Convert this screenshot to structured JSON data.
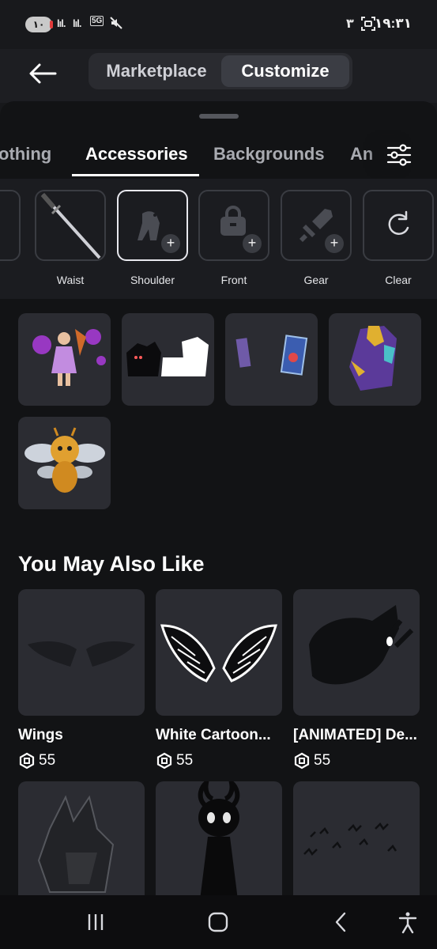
{
  "status_bar": {
    "battery": "١٠",
    "network": "5G",
    "time": "١٩:٣١",
    "sim_indicator": "٣",
    "signal_1": "lıl.",
    "signal_2": "lıl."
  },
  "header": {
    "back_icon": "arrow-left-icon",
    "tabs": [
      {
        "label": "Marketplace",
        "active": false
      },
      {
        "label": "Customize",
        "active": true
      }
    ]
  },
  "category_tabs": [
    {
      "label": "Clothing",
      "visible_text": "othing",
      "active": false
    },
    {
      "label": "Accessories",
      "visible_text": "Accessories",
      "active": true
    },
    {
      "label": "Backgrounds",
      "visible_text": "Backgrounds",
      "active": false
    },
    {
      "label": "Animations",
      "visible_text": "An",
      "active": false
    }
  ],
  "filter_icon": "sliders-icon",
  "subcategories": [
    {
      "label": "Waist",
      "icon": "katana-icon",
      "selected": false
    },
    {
      "label": "Shoulder",
      "icon": "shoulder-icon",
      "selected": true
    },
    {
      "label": "Front",
      "icon": "backpack-icon",
      "selected": false
    },
    {
      "label": "Gear",
      "icon": "sword-icon",
      "selected": false
    },
    {
      "label": "Clear",
      "icon": "refresh-icon",
      "selected": false
    }
  ],
  "equipped_items": [
    {
      "name": "fairy-doll-accessory"
    },
    {
      "name": "shadow-creatures-accessory"
    },
    {
      "name": "floating-cards-accessory"
    },
    {
      "name": "purple-gold-armor-accessory"
    },
    {
      "name": "golden-bee-fairy-accessory"
    }
  ],
  "recommendations": {
    "title": "You May Also Like",
    "items": [
      {
        "name": "Wings",
        "price": "55"
      },
      {
        "name": "White Cartoon...",
        "price": "55"
      },
      {
        "name": "[ANIMATED] De...",
        "price": "55"
      },
      {
        "name": "",
        "price": ""
      },
      {
        "name": "",
        "price": ""
      },
      {
        "name": "",
        "price": ""
      }
    ]
  },
  "nav_bar": [
    "recent-apps-icon",
    "home-icon",
    "back-icon",
    "accessibility-icon"
  ],
  "colors": {
    "background": "#121315",
    "card": "#2b2c32",
    "accent_active": "#ffffff",
    "muted": "#a9abb1"
  }
}
